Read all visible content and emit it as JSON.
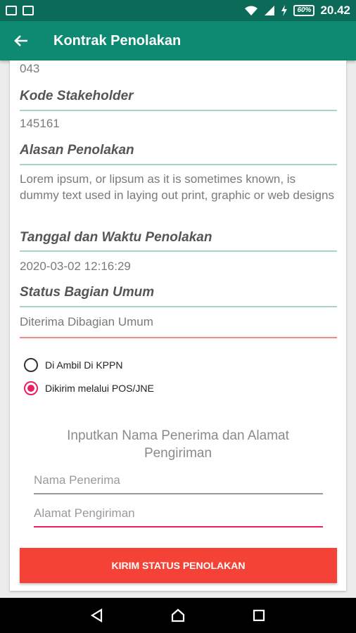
{
  "status_bar": {
    "time": "20.42",
    "battery": "60%",
    "icons": [
      "image-icon",
      "keyboard-icon",
      "wifi-icon",
      "signal-icon",
      "charging-icon"
    ]
  },
  "app_bar": {
    "title": "Kontrak Penolakan",
    "back_icon": "arrow-left-icon"
  },
  "details": {
    "partial_value": "043",
    "fields": [
      {
        "label": "Kode Stakeholder",
        "value": "145161"
      },
      {
        "label": "Alasan Penolakan",
        "value": "Lorem ipsum, or lipsum as it is sometimes known, is dummy text used in laying out print, graphic or web designs"
      },
      {
        "label": "Tanggal dan Waktu Penolakan",
        "value": "2020-03-02 12:16:29"
      },
      {
        "label": "Status Bagian Umum",
        "value": "Diterima Dibagian Umum"
      }
    ]
  },
  "delivery_options": [
    {
      "label": "Di Ambil Di KPPN",
      "checked": false
    },
    {
      "label": "Dikirim melalui POS/JNE",
      "checked": true
    }
  ],
  "recipient_form": {
    "title": "Inputkan Nama Penerima dan Alamat Pengiriman",
    "name_placeholder": "Nama Penerima",
    "address_placeholder": "Alamat Pengiriman"
  },
  "submit_label": "KIRIM STATUS PENOLAKAN",
  "colors": {
    "primary": "#0f8a72",
    "status_bar": "#0b6b58",
    "accent": "#e91e63",
    "button": "#f44336"
  }
}
